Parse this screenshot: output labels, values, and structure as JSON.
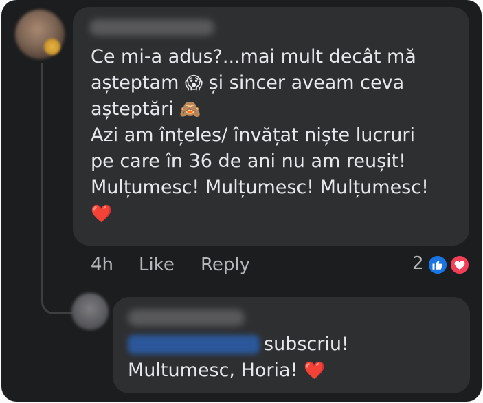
{
  "comment": {
    "text_line1": "Ce mi-a adus?...mai mult decât mă",
    "text_line2a": "așteptam ",
    "emoji_scream": "😱",
    "text_line2b": " și sincer aveam ceva",
    "text_line3": "așteptări ",
    "emoji_see_no_evil": "🙈",
    "text_line4": "Azi am înțeles/ învățat niște lucruri",
    "text_line5": "pe care în 36 de ani nu am reușit!",
    "text_line6": "Mulțumesc! Mulțumesc! Mulțumesc!",
    "emoji_heart": "❤️"
  },
  "actions": {
    "time": "4h",
    "like": "Like",
    "reply": "Reply",
    "reaction_count": "2"
  },
  "reply": {
    "line1": "subscriu!",
    "line2": "Multumesc, Horia! ",
    "emoji_heart": "❤️"
  },
  "colors": {
    "background": "#1c1d1f",
    "bubble": "#2e2f31",
    "text": "#e7e8ec",
    "secondary_text": "#b4b6ba",
    "like_blue": "#1b74e4",
    "love_red": "#f33e58"
  },
  "icons": {
    "like": "thumbs-up-icon",
    "love": "heart-icon"
  }
}
